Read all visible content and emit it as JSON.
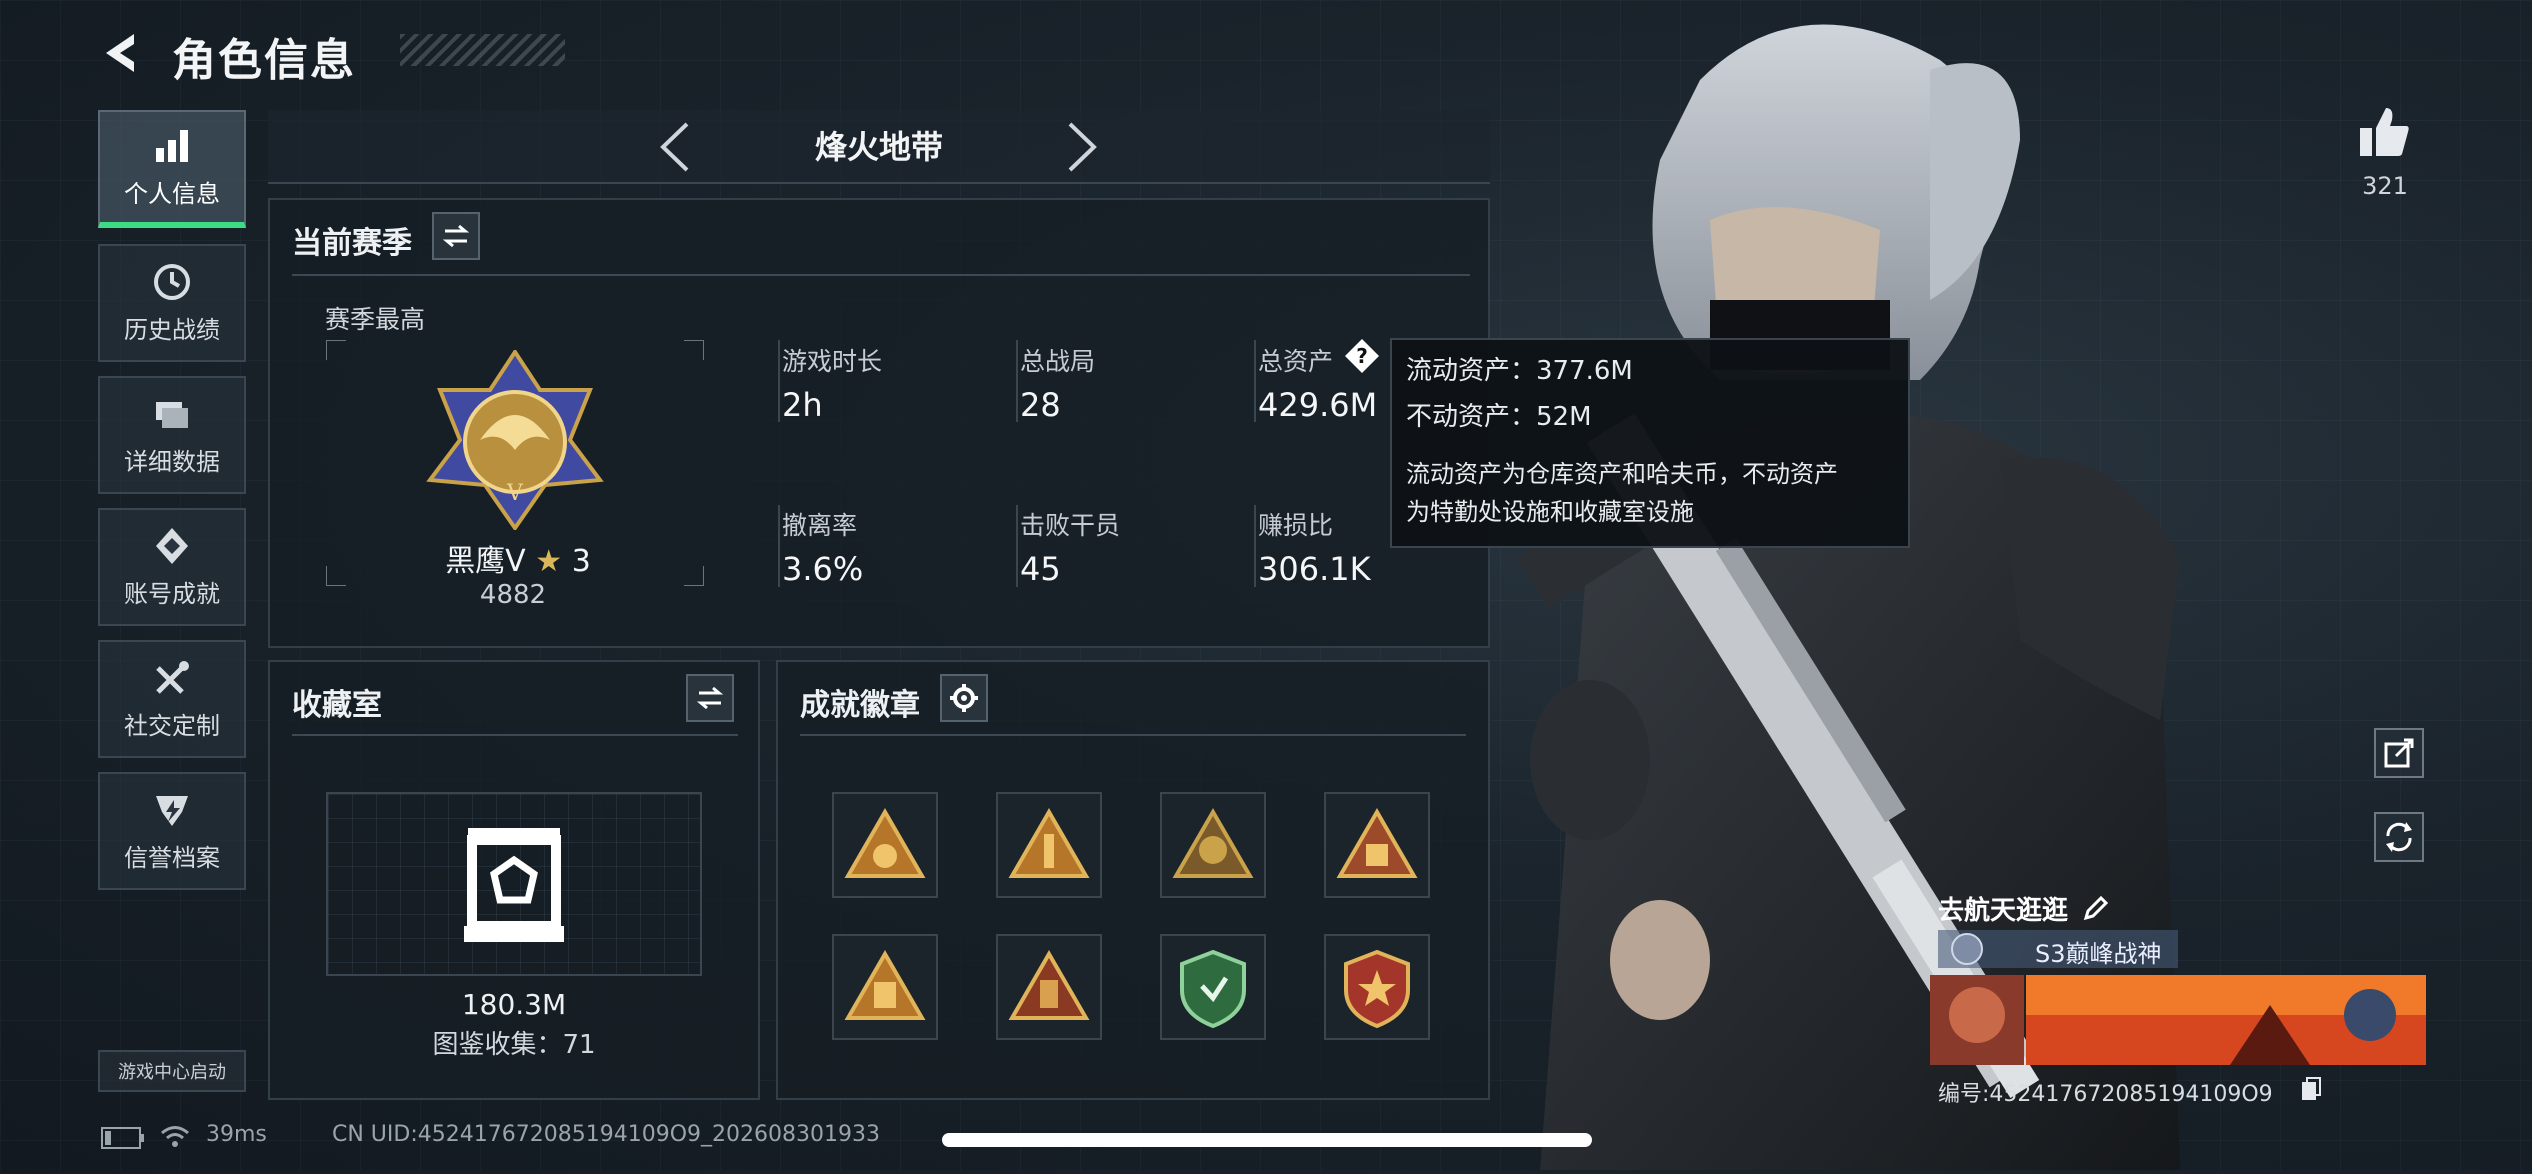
{
  "header": {
    "title": "角色信息"
  },
  "sidebar": {
    "items": [
      {
        "label": "个人信息",
        "icon": "bar-chart-icon"
      },
      {
        "label": "历史战绩",
        "icon": "history-icon"
      },
      {
        "label": "详细数据",
        "icon": "folder-icon"
      },
      {
        "label": "账号成就",
        "icon": "achievement-icon"
      },
      {
        "label": "社交定制",
        "icon": "tools-icon"
      },
      {
        "label": "信誉档案",
        "icon": "reputation-icon"
      }
    ],
    "game_center": "游戏中心启动"
  },
  "map": {
    "title": "烽火地带"
  },
  "season": {
    "title": "当前赛季",
    "peak_label": "赛季最高",
    "rank_name": "黑鹰V",
    "rank_stars": "3",
    "rank_score": "4882",
    "stats": [
      {
        "label": "游戏时长",
        "value": "2h"
      },
      {
        "label": "总战局",
        "value": "28"
      },
      {
        "label": "总资产",
        "value": "429.6M"
      },
      {
        "label": "撤离率",
        "value": "3.6%"
      },
      {
        "label": "击败干员",
        "value": "45"
      },
      {
        "label": "赚损比",
        "value": "306.1K"
      }
    ]
  },
  "tooltip": {
    "liquid": "流动资产：377.6M",
    "fixed": "不动资产：52M",
    "desc_line1": "流动资产为仓库资产和哈夫币，不动资产",
    "desc_line2": "为特勤处设施和收藏室设施"
  },
  "collection": {
    "title": "收藏室",
    "value": "180.3M",
    "count_label": "图鉴收集：71"
  },
  "badges": {
    "title": "成就徽章",
    "items": [
      "badge-1",
      "badge-2",
      "badge-3",
      "badge-4",
      "badge-5",
      "badge-6",
      "badge-7",
      "badge-8"
    ]
  },
  "player_card": {
    "name": "去航天逛逛",
    "title": "S3巅峰战神",
    "id": "编号:452417672085194109O9"
  },
  "likes": {
    "count": "321"
  },
  "status": {
    "ping": "39ms",
    "uid": "CN UID:452417672085194109O9_202608301933"
  },
  "colors": {
    "accent": "#3ddc84",
    "gold": "#c9a24a",
    "panel": "#161e25"
  }
}
